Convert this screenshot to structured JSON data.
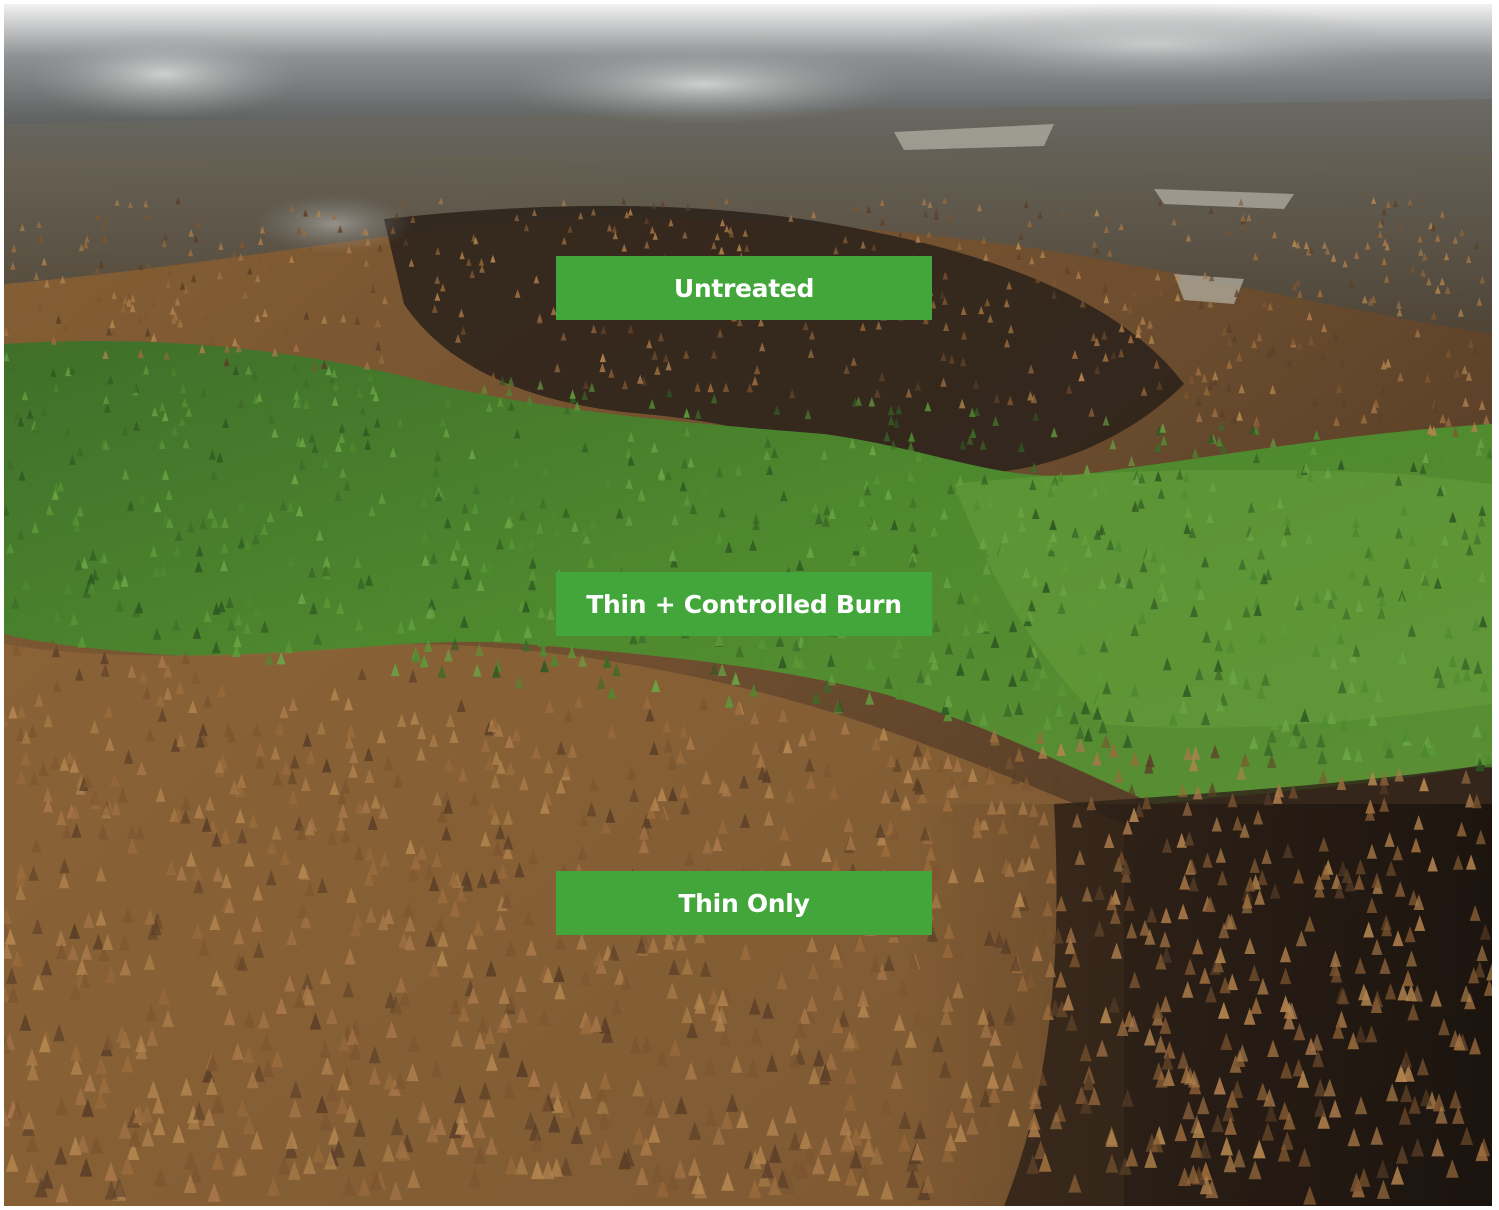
{
  "labels": {
    "untreated": "Untreated",
    "thin_controlled_burn": "Thin + Controlled Burn",
    "thin_only": "Thin Only"
  },
  "colors": {
    "label_background": "#43a63b",
    "label_text": "#ffffff",
    "healthy_forest": "#4f8a2e",
    "scorched_forest": "#9a6b3c",
    "burned_ground": "#2e2219",
    "smoke": "#8f9294"
  }
}
